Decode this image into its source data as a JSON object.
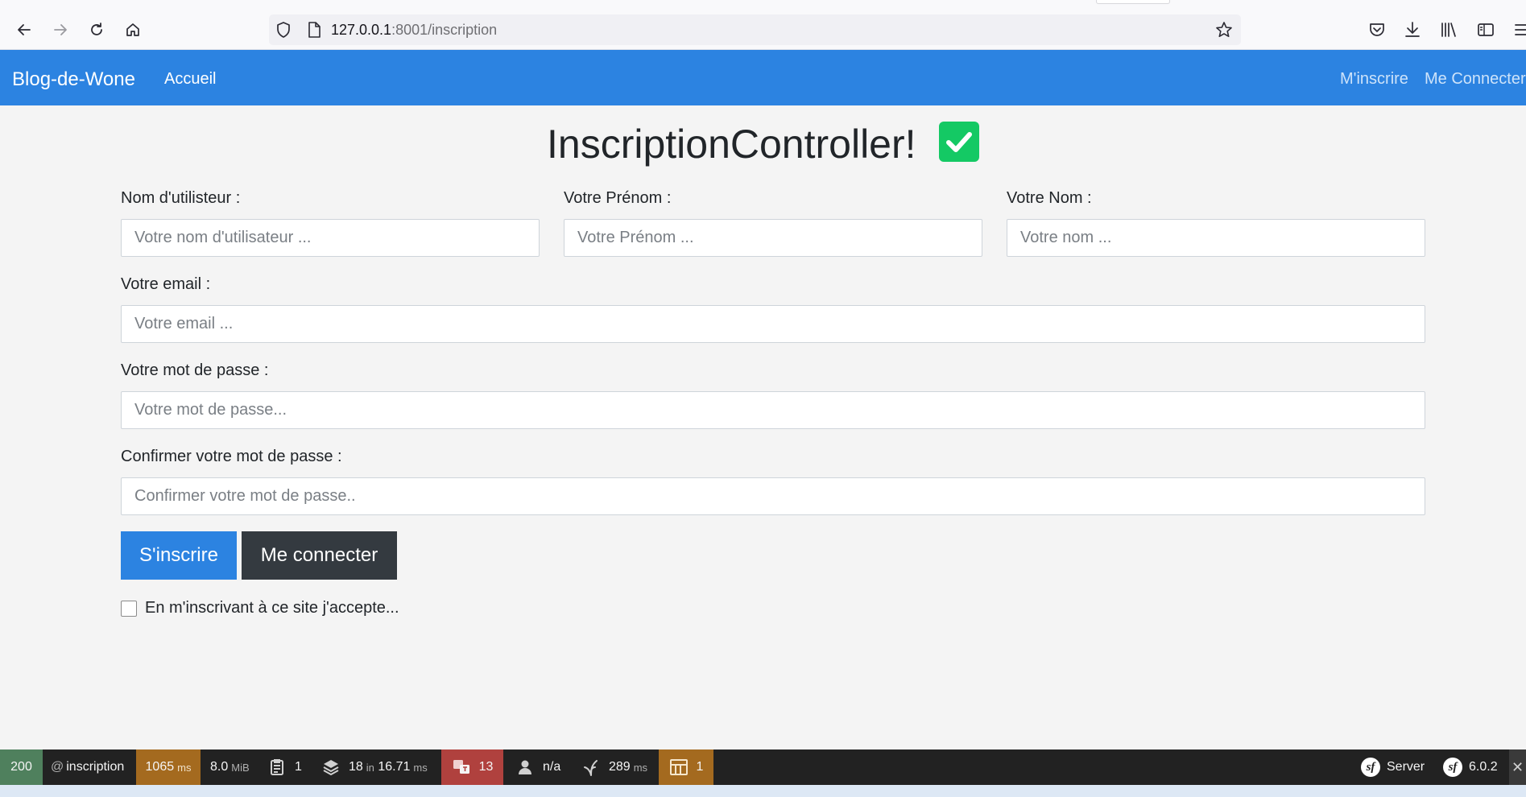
{
  "browser": {
    "url_host": "127.0.0.1",
    "url_path": ":8001/inscription"
  },
  "navbar": {
    "brand": "Blog-de-Wone",
    "home": "Accueil",
    "signup": "M'inscrire",
    "login": "Me Connecter"
  },
  "page": {
    "title": "InscriptionController!"
  },
  "form": {
    "username_label": "Nom d'utilisteur :",
    "username_placeholder": "Votre nom d'utilisateur ...",
    "firstname_label": "Votre Prénom :",
    "firstname_placeholder": "Votre Prénom ...",
    "lastname_label": "Votre Nom :",
    "lastname_placeholder": "Votre nom ...",
    "email_label": "Votre email :",
    "email_placeholder": "Votre email ...",
    "password_label": "Votre mot de passe :",
    "password_placeholder": "Votre mot de passe...",
    "confirm_label": "Confirmer votre mot de passe :",
    "confirm_placeholder": "Confirmer votre mot de passe..",
    "submit_label": "S'inscrire",
    "login_label": "Me connecter",
    "terms_label": "En m'inscrivant à ce site j'accepte..."
  },
  "toolbar": {
    "status": "200",
    "route_prefix": "@",
    "route": "inscription",
    "time_value": "1065",
    "time_unit": "ms",
    "memory_value": "8.0",
    "memory_unit": "MiB",
    "logs_count": "1",
    "cache_count": "18",
    "cache_in": "in",
    "cache_time": "16.71",
    "cache_unit": "ms",
    "translation_count": "13",
    "user": "n/a",
    "twig_time": "289",
    "twig_unit": "ms",
    "forms_count": "1",
    "server_label": "Server",
    "version": "6.0.2"
  },
  "colors": {
    "navbar": "#2c83e1",
    "primary_button": "#2c83e1",
    "dark_button": "#343a40",
    "check_badge": "#14c964",
    "status_ok": "#4f805d",
    "time_warning": "#a46a1f",
    "translation_error": "#b0413e"
  },
  "icons": {
    "back": "back-arrow-icon",
    "forward": "forward-arrow-icon",
    "reload": "reload-icon",
    "home": "home-icon",
    "shield": "shield-icon",
    "page": "page-icon",
    "bookmark": "star-icon",
    "pocket": "pocket-icon",
    "download": "download-icon",
    "library": "library-icon",
    "sidebar": "sidebar-icon",
    "menu": "menu-icon",
    "check": "check-icon"
  }
}
